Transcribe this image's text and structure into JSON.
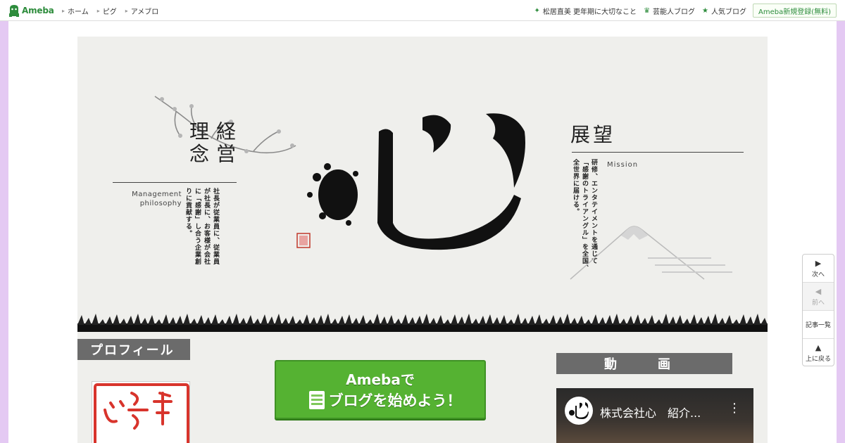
{
  "topbar": {
    "logo": "Ameba",
    "nav_left": [
      "ホーム",
      "ピグ",
      "アメブロ"
    ],
    "nav_right": [
      {
        "icon": "green-sparkle-icon",
        "label": "松居直美 更年期に大切なこと"
      },
      {
        "icon": "crown-icon",
        "label": "芸能人ブログ"
      },
      {
        "icon": "star-icon",
        "label": "人気ブログ"
      }
    ],
    "signup": "Ameba新規登録(無料)"
  },
  "header": {
    "philosophy_title": "経営理念",
    "philosophy_en_1": "Management",
    "philosophy_en_2": "philosophy",
    "philosophy_body": "社長が従業員に、従業員が社長に、お客様が会社に「感謝」し合う企業創りに貢献する。",
    "vision_title": "展望",
    "vision_en": "Mission",
    "vision_body": "研修、エンタテイメントを通じて「感謝のトライアングル」を全国、全世界に届ける。"
  },
  "sections": {
    "profile": "プロフィール",
    "video": "動　画"
  },
  "cta": {
    "line1": "Amebaで",
    "line2": "ブログを始めよう！"
  },
  "video": {
    "title": "株式会社心　紹介...",
    "more": "⋮"
  },
  "sidenav": {
    "next": "次へ",
    "prev": "前へ",
    "list": "記事一覧",
    "top": "上に戻る"
  },
  "colors": {
    "brand_green": "#2d8c3c",
    "cta_green": "#55b232",
    "page_bg": "#e4c9f3",
    "section_head": "#6b6b6b"
  }
}
